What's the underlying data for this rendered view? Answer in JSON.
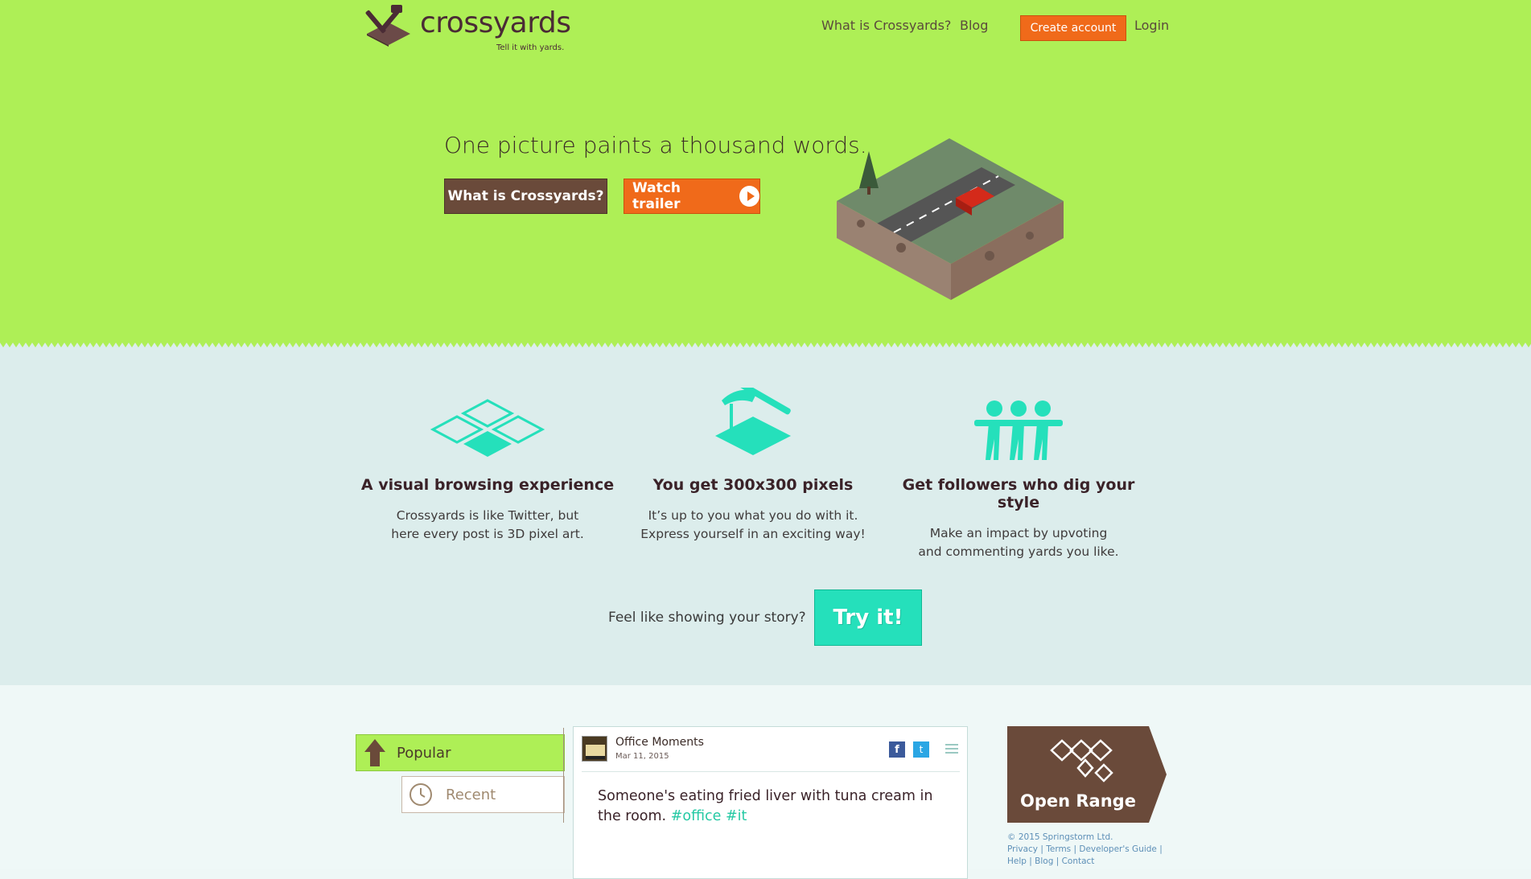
{
  "brand": {
    "name": "crossyards",
    "tagline": "Tell it with yards."
  },
  "nav": {
    "what_is": "What is Crossyards?",
    "blog": "Blog",
    "create_account": "Create account",
    "login": "Login"
  },
  "hero": {
    "title": "One picture paints a thousand words.",
    "what_button": "What is Crossyards?",
    "trailer_button": "Watch trailer"
  },
  "features": [
    {
      "title": "A visual browsing experience",
      "desc_line1": "Crossyards is like Twitter, but",
      "desc_line2": "here every post is 3D pixel art."
    },
    {
      "title": "You get 300x300 pixels",
      "desc_line1": "It’s up to you what you do with it.",
      "desc_line2": "Express yourself in an exciting way!"
    },
    {
      "title": "Get followers who dig your style",
      "desc_line1": "Make an impact by upvoting",
      "desc_line2": "and commenting yards you like."
    }
  ],
  "cta": {
    "text": "Feel like showing your story?",
    "button": "Try it!"
  },
  "tabs": {
    "popular": "Popular",
    "recent": "Recent"
  },
  "post": {
    "author": "Office Moments",
    "date": "Mar 11, 2015",
    "text": "Someone's eating fried liver with tuna cream in the room.",
    "tags": "#office #it",
    "share_fb": "f",
    "share_tw": "t"
  },
  "open_range": {
    "label": "Open Range"
  },
  "footer": {
    "copyright": "© 2015 Springstorm Ltd.",
    "links_line1": "Privacy | Terms | Developer's Guide |",
    "links_line2": "Help | Blog | Contact"
  },
  "colors": {
    "hero_green": "#aeef56",
    "accent_orange": "#f06a1a",
    "brown": "#6a4a3a",
    "teal": "#25e0bb",
    "features_bg": "#dcedec"
  },
  "icons": [
    "shovel-logo-icon",
    "play-icon",
    "tiles-icon",
    "hammer-tile-icon",
    "people-icon",
    "arrow-up-icon",
    "clock-icon",
    "facebook-icon",
    "twitter-icon",
    "menu-icon",
    "open-range-icon"
  ]
}
